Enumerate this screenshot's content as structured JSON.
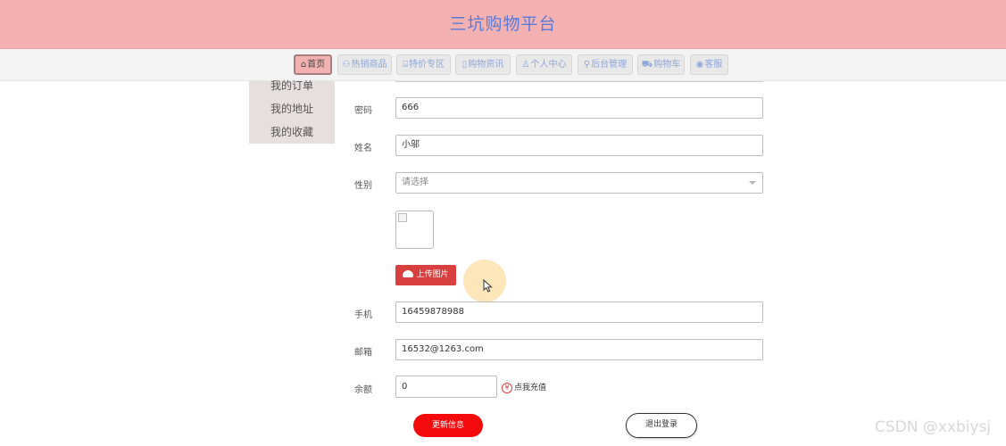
{
  "header": {
    "title": "三坑购物平台"
  },
  "nav": {
    "items": [
      {
        "icon": "⌂",
        "label": "首页",
        "active": true
      },
      {
        "icon": "⚇",
        "label": "热销商品"
      },
      {
        "icon": "⌸",
        "label": "特价专区"
      },
      {
        "icon": "▯",
        "label": "购物资讯"
      },
      {
        "icon": "♙",
        "label": "个人中心"
      },
      {
        "icon": "⚲",
        "label": "后台管理"
      },
      {
        "icon": "⛟",
        "label": "购物车"
      },
      {
        "icon": "◉",
        "label": "客服"
      }
    ]
  },
  "sidebar": {
    "items": [
      "我的订单",
      "我的地址",
      "我的收藏"
    ]
  },
  "form": {
    "password": {
      "label": "密码",
      "value": "666"
    },
    "name": {
      "label": "姓名",
      "value": "小邬"
    },
    "gender": {
      "label": "性别",
      "placeholder": "请选择"
    },
    "upload_label": "上传图片",
    "phone": {
      "label": "手机",
      "value": "16459878988"
    },
    "email": {
      "label": "邮箱",
      "value": "16532@1263.com"
    },
    "balance": {
      "label": "余额",
      "value": "0"
    },
    "recharge_icon": "¥",
    "recharge_label": "点我充值",
    "update_button": "更新信息",
    "logout_button": "退出登录"
  },
  "watermark": "CSDN @xxbiysj",
  "colors": {
    "header_bg": "#f4b1b1",
    "title": "#5a7ad6",
    "accent_red": "#d8403f",
    "update_btn": "#f4090c"
  }
}
